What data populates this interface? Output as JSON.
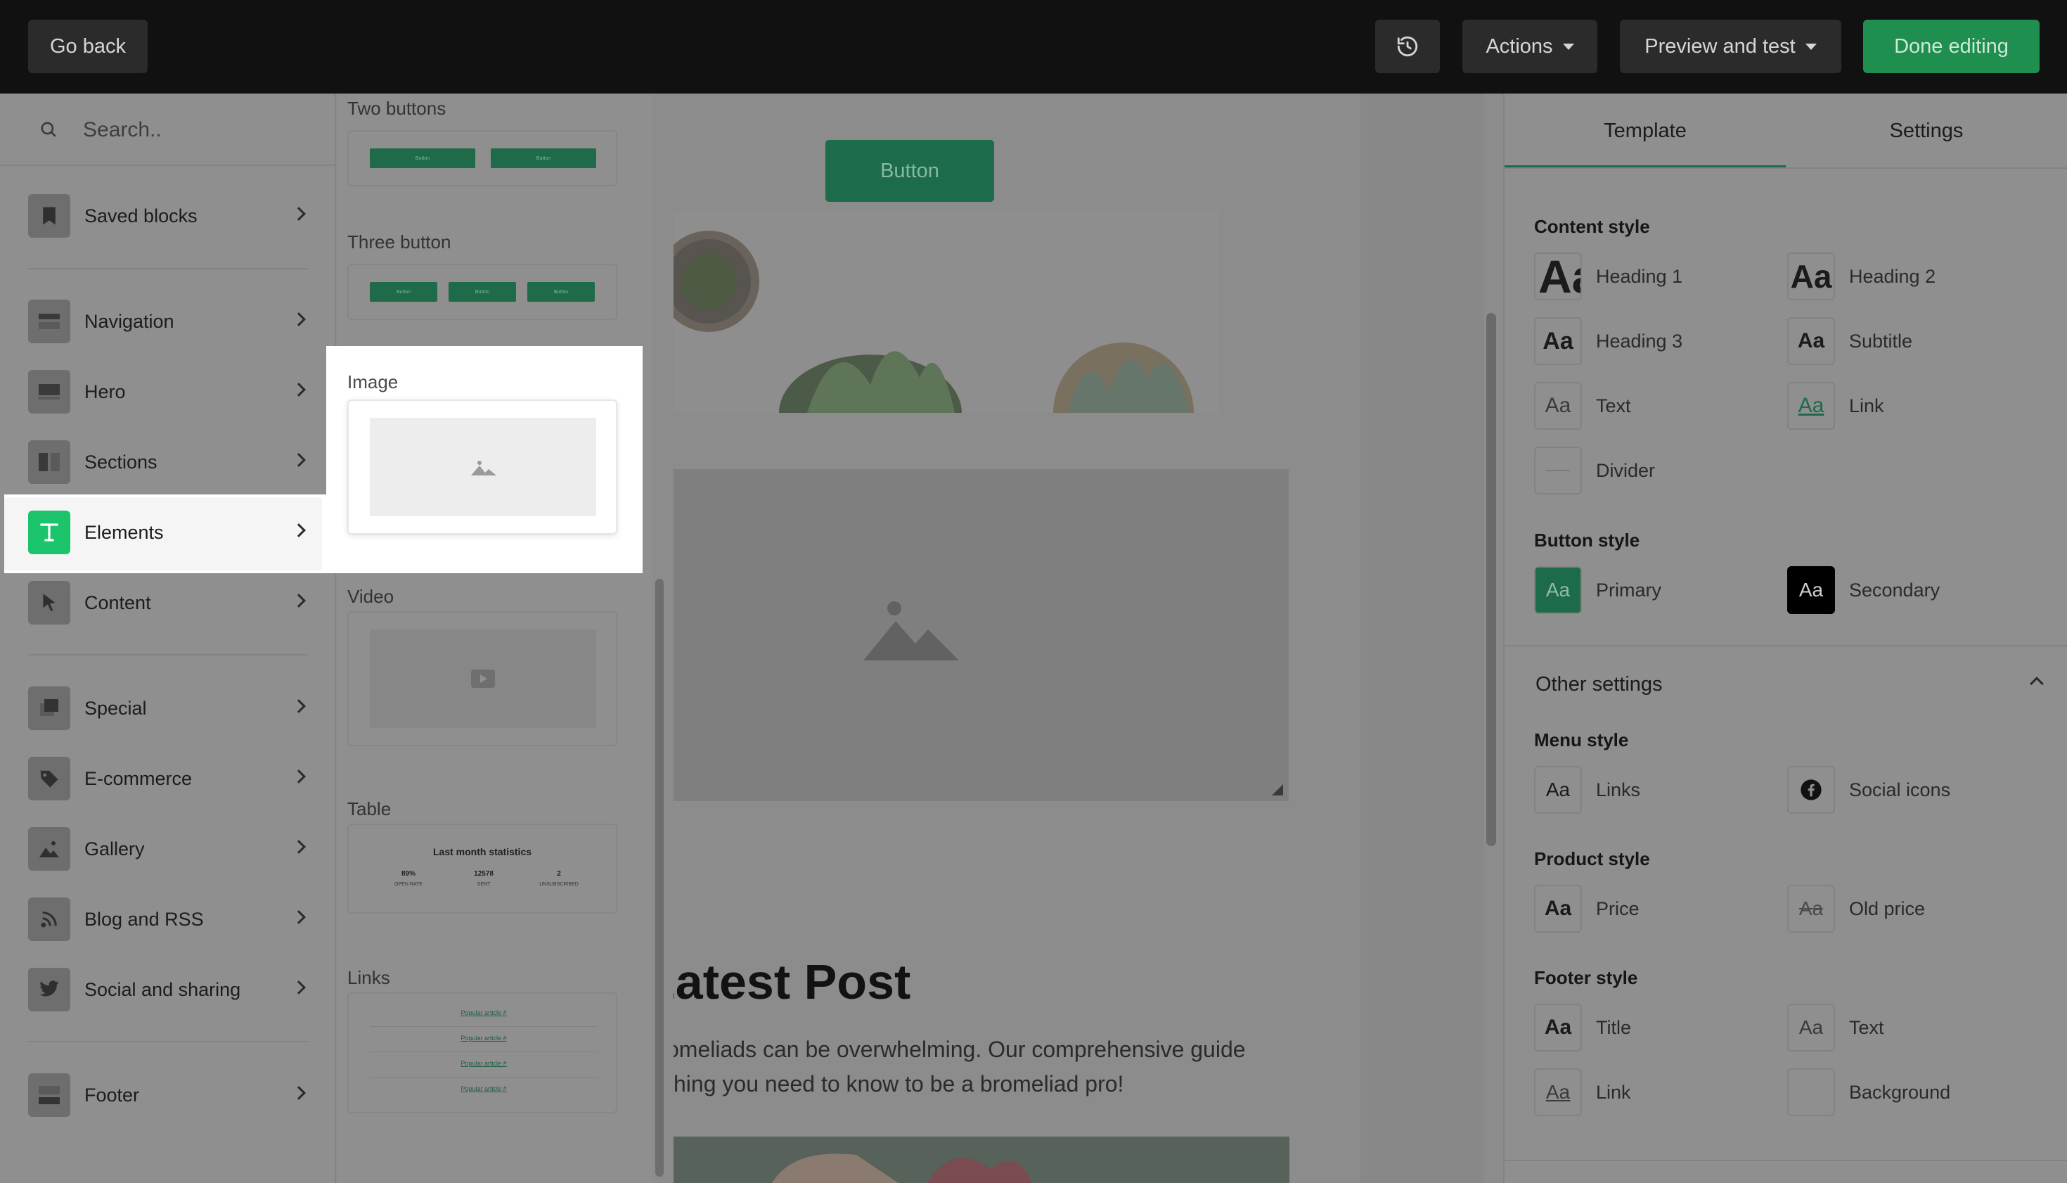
{
  "topbar": {
    "back_label": "Go back",
    "history_icon": "history-icon",
    "actions_label": "Actions",
    "preview_label": "Preview and test",
    "done_label": "Done editing",
    "done_color": "#1e8f4e"
  },
  "search": {
    "placeholder": "Search.."
  },
  "sidebar": {
    "items": [
      {
        "label": "Saved blocks",
        "icon": "bookmark-icon"
      },
      {
        "label": "Navigation",
        "icon": "navigation-block-icon"
      },
      {
        "label": "Hero",
        "icon": "hero-block-icon"
      },
      {
        "label": "Sections",
        "icon": "sections-block-icon"
      },
      {
        "label": "Elements",
        "icon": "text-t-icon",
        "active": true
      },
      {
        "label": "Content",
        "icon": "cursor-arrow-icon"
      },
      {
        "label": "Special",
        "icon": "special-block-icon"
      },
      {
        "label": "E-commerce",
        "icon": "tag-icon"
      },
      {
        "label": "Gallery",
        "icon": "gallery-image-icon"
      },
      {
        "label": "Blog and RSS",
        "icon": "rss-icon"
      },
      {
        "label": "Social and sharing",
        "icon": "twitter-bird-icon"
      },
      {
        "label": "Footer",
        "icon": "footer-block-icon"
      }
    ]
  },
  "elements": {
    "two_buttons": {
      "title": "Two buttons",
      "button": "Button"
    },
    "three_button": {
      "title": "Three button",
      "button": "Button"
    },
    "image": {
      "title": "Image"
    },
    "video": {
      "title": "Video"
    },
    "table": {
      "title": "Table",
      "heading": "Last month statistics",
      "stats": [
        {
          "value": "89%",
          "label": "OPEN RATE"
        },
        {
          "value": "12578",
          "label": "SENT"
        },
        {
          "value": "2",
          "label": "UNSUBSCRIBED"
        }
      ]
    },
    "links": {
      "title": "Links",
      "items": [
        "Popular article #",
        "Popular article #",
        "Popular article #",
        "Popular article #"
      ]
    }
  },
  "canvas": {
    "button_label": "Button",
    "post_title": "Latest Post",
    "post_body_line1": "Bromeliads can be overwhelming. Our comprehensive guide",
    "post_body_line2": "hing you need to know to be a bromeliad pro!"
  },
  "right_panel": {
    "tabs": [
      "Template",
      "Settings"
    ],
    "content_style": {
      "heading": "Content style",
      "items": [
        "Heading 1",
        "Heading 2",
        "Heading 3",
        "Subtitle",
        "Text",
        "Link",
        "Divider"
      ]
    },
    "button_style": {
      "heading": "Button style",
      "primary": "Primary",
      "secondary": "Secondary",
      "primary_color": "#1c6b4a",
      "secondary_color": "#000000"
    },
    "other_settings": "Other settings",
    "menu_style": {
      "heading": "Menu style",
      "links": "Links",
      "social": "Social icons"
    },
    "product_style": {
      "heading": "Product style",
      "price": "Price",
      "old_price": "Old price"
    },
    "footer_style": {
      "heading": "Footer style",
      "title": "Title",
      "text": "Text",
      "link": "Link",
      "background": "Background"
    },
    "swatch_glyph": "Aa"
  }
}
